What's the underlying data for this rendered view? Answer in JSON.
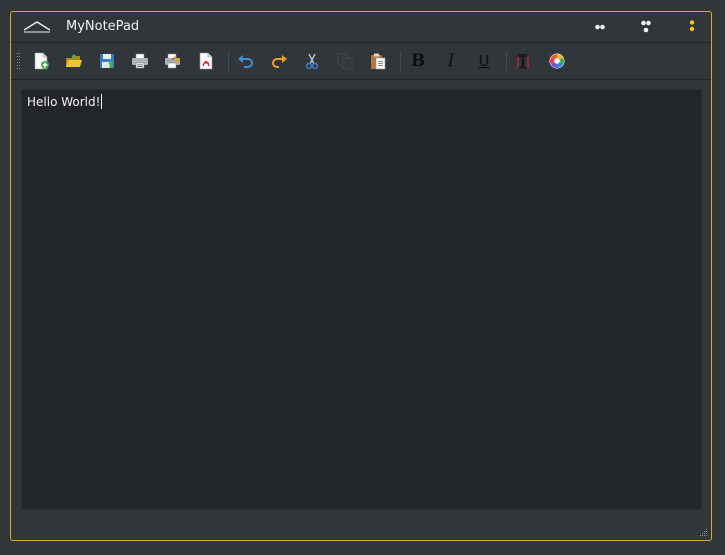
{
  "window": {
    "title": "MyNotePad"
  },
  "toolbar": {
    "items": [
      {
        "name": "new-file",
        "icon": "new-document-icon"
      },
      {
        "name": "open-file",
        "icon": "open-folder-icon"
      },
      {
        "name": "save-file",
        "icon": "save-icon"
      },
      {
        "name": "print",
        "icon": "printer-icon"
      },
      {
        "name": "print-preview",
        "icon": "print-preview-icon"
      },
      {
        "name": "export-pdf",
        "icon": "pdf-icon"
      },
      {
        "name": "undo",
        "icon": "undo-icon"
      },
      {
        "name": "redo",
        "icon": "redo-icon"
      },
      {
        "name": "cut",
        "icon": "scissors-icon"
      },
      {
        "name": "copy",
        "icon": "copy-icon",
        "disabled": true
      },
      {
        "name": "paste",
        "icon": "paste-icon"
      },
      {
        "name": "bold",
        "label": "B"
      },
      {
        "name": "italic",
        "label": "I"
      },
      {
        "name": "underline",
        "label": "U"
      },
      {
        "name": "font",
        "icon": "font-icon"
      },
      {
        "name": "color",
        "icon": "color-wheel-icon"
      }
    ],
    "bold_label": "B",
    "italic_label": "I",
    "underline_label": "U"
  },
  "editor": {
    "content": "Hello World!"
  },
  "colors": {
    "accent": "#d9a82a",
    "background": "#31363b",
    "editor_background": "#232629",
    "text": "#eff0f1"
  }
}
